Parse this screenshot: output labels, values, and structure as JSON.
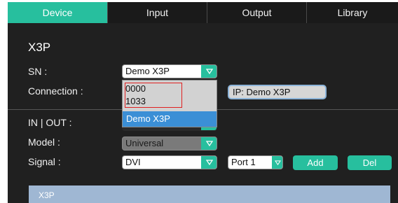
{
  "tabs": [
    "Device",
    "Input",
    "Output",
    "Library"
  ],
  "active_tab": "Device",
  "device": {
    "title": "X3P",
    "sn_label": "SN :",
    "sn_value": "Demo X3P",
    "connection_label": "Connection :",
    "ip_text": "IP: Demo X3P"
  },
  "sn_dropdown": {
    "options": [
      "0000",
      "1033",
      "Demo X3P"
    ],
    "selected": "Demo X3P"
  },
  "io": {
    "in_out_label": "IN | OUT :",
    "model_label": "Model :",
    "model_value": "Universal",
    "signal_label": "Signal :",
    "signal_value": "DVI",
    "port_value": "Port 1",
    "add_label": "Add",
    "del_label": "Del"
  },
  "preview": {
    "label": "X3P"
  },
  "colors": {
    "accent": "#27bf9e",
    "panel": "#202020",
    "selection": "#3b8fd6",
    "highlight": "#e02020"
  }
}
